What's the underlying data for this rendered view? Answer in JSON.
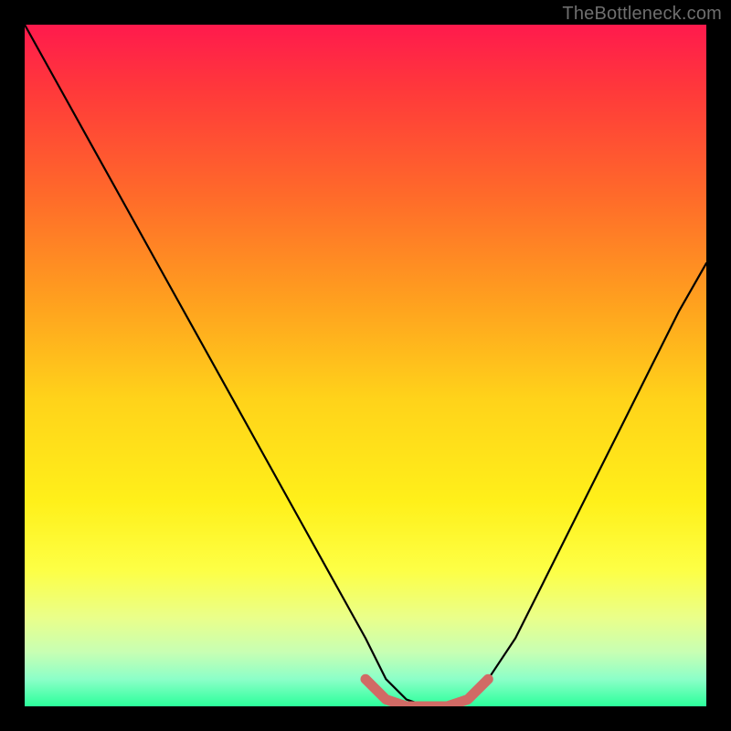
{
  "watermark": "TheBottleneck.com",
  "colors": {
    "frame": "#000000",
    "curve": "#000000",
    "highlight": "#d16a65",
    "gradient_top": "#ff1a4d",
    "gradient_bottom": "#2bff9b"
  },
  "chart_data": {
    "type": "line",
    "title": "",
    "xlabel": "",
    "ylabel": "",
    "xlim": [
      0,
      100
    ],
    "ylim": [
      0,
      100
    ],
    "grid": false,
    "legend": false,
    "annotations": [],
    "series": [
      {
        "name": "bottleneck-curve",
        "x": [
          0,
          5,
          10,
          15,
          20,
          25,
          30,
          35,
          40,
          45,
          50,
          53,
          56,
          59,
          62,
          65,
          68,
          72,
          76,
          80,
          84,
          88,
          92,
          96,
          100
        ],
        "values": [
          100,
          91,
          82,
          73,
          64,
          55,
          46,
          37,
          28,
          19,
          10,
          4,
          1,
          0,
          0,
          1,
          4,
          10,
          18,
          26,
          34,
          42,
          50,
          58,
          65
        ]
      }
    ],
    "highlight_segment": {
      "x": [
        50,
        53,
        56,
        59,
        62,
        65,
        68
      ],
      "values": [
        4,
        1,
        0,
        0,
        0,
        1,
        4
      ]
    }
  }
}
